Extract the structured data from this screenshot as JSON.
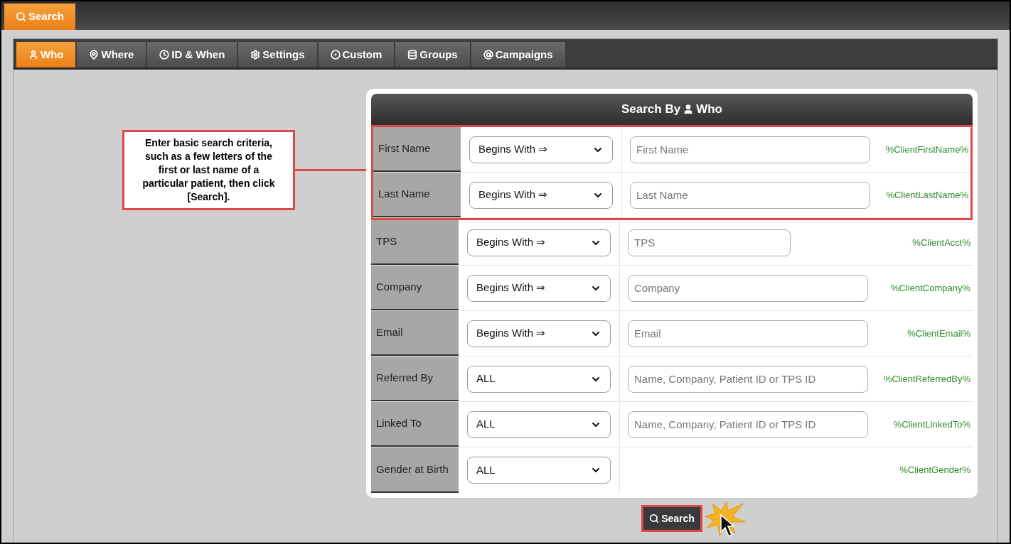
{
  "top_tab": {
    "label": "Search",
    "selected": true
  },
  "tabs": [
    {
      "label": "Who",
      "selected": true
    },
    {
      "label": "Where",
      "selected": false
    },
    {
      "label": "ID & When",
      "selected": false
    },
    {
      "label": "Settings",
      "selected": false
    },
    {
      "label": "Custom",
      "selected": false
    },
    {
      "label": "Groups",
      "selected": false
    },
    {
      "label": "Campaigns",
      "selected": false
    }
  ],
  "callout": "Enter basic search criteria, such as a few letters of the first or last name of a particular patient, then click [Search].",
  "panel": {
    "title": "Search By",
    "title_suffix": "Who"
  },
  "rows": [
    {
      "label": "First Name",
      "kind": "text",
      "match": "Begins With ⇒",
      "placeholder": "First Name",
      "tag": "%ClientFirstName%",
      "highlighted": true
    },
    {
      "label": "Last Name",
      "kind": "text",
      "match": "Begins With ⇒",
      "placeholder": "Last Name",
      "tag": "%ClientLastName%",
      "highlighted": true
    },
    {
      "label": "TPS",
      "kind": "short",
      "match": "Begins With ⇒",
      "placeholder": "TPS",
      "tag": "%ClientAcct%",
      "highlighted": false
    },
    {
      "label": "Company",
      "kind": "text",
      "match": "Begins With ⇒",
      "placeholder": "Company",
      "tag": "%ClientCompany%",
      "highlighted": false
    },
    {
      "label": "Email",
      "kind": "text",
      "match": "Begins With ⇒",
      "placeholder": "Email",
      "tag": "%ClientEmail%",
      "highlighted": false
    },
    {
      "label": "Referred By",
      "kind": "text",
      "match": "ALL",
      "placeholder": "Name, Company, Patient ID or TPS ID",
      "tag": "%ClientReferredBy%",
      "highlighted": false
    },
    {
      "label": "Linked To",
      "kind": "text",
      "match": "ALL",
      "placeholder": "Name, Company, Patient ID or TPS ID",
      "tag": "%ClientLinkedTo%",
      "highlighted": false
    },
    {
      "label": "Gender at Birth",
      "kind": "select",
      "match": "ALL",
      "tag": "%ClientGender%",
      "highlighted": false
    }
  ],
  "search_button": "Search"
}
